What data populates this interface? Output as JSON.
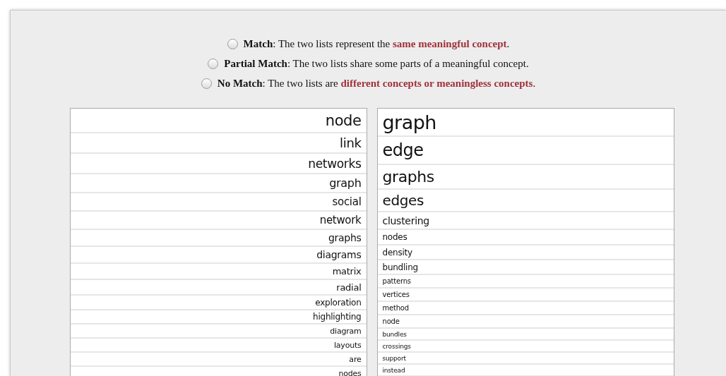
{
  "options": [
    {
      "label": "Match",
      "text": ": The two lists represent the **same meaningful concept**.",
      "selected": false
    },
    {
      "label": "Partial Match",
      "text": ": The two lists share some parts of a meaningful concept.",
      "selected": false
    },
    {
      "label": "No Match",
      "text": ": The two lists are **different concepts or meaningless concepts**.",
      "selected": false
    }
  ],
  "left_list": [
    "node",
    "link",
    "networks",
    "graph",
    "social",
    "network",
    "graphs",
    "diagrams",
    "matrix",
    "radial",
    "exploration",
    "highlighting",
    "diagram",
    "layouts",
    "are",
    "nodes"
  ],
  "right_list": [
    "graph",
    "edge",
    "graphs",
    "edges",
    "clustering",
    "nodes",
    "density",
    "bundling",
    "patterns",
    "vertices",
    "method",
    "node",
    "bundles",
    "crossings",
    "support",
    "instead"
  ]
}
